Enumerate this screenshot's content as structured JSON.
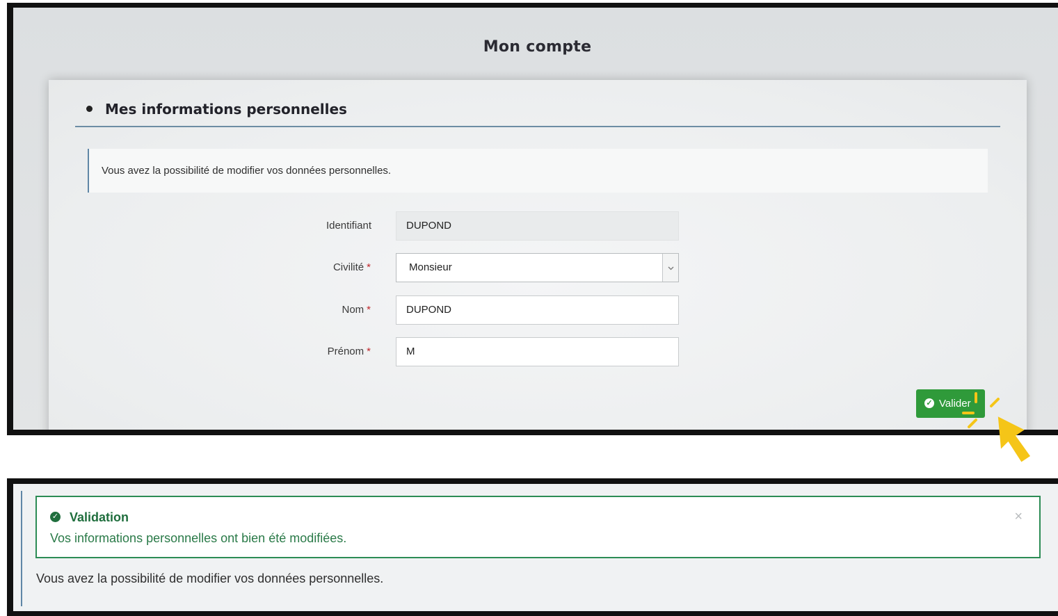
{
  "account": {
    "page_title": "Mon compte",
    "section_title": "Mes informations personnelles",
    "info_text": "Vous avez la possibilité de modifier vos données personnelles.",
    "required_mark": "*",
    "fields": {
      "identifiant": {
        "label": "Identifiant",
        "value": "DUPOND"
      },
      "civilite": {
        "label": "Civilité",
        "value": "Monsieur"
      },
      "nom": {
        "label": "Nom",
        "value": "DUPOND"
      },
      "prenom": {
        "label": "Prénom",
        "value": "M"
      }
    },
    "validate_label": "Valider"
  },
  "confirmation": {
    "alert_title": "Validation",
    "alert_message": "Vos informations personnelles ont bien été modifiées.",
    "close_symbol": "×",
    "info_text": "Vous avez la possibilité de modifier vos données personnelles."
  },
  "icons": {
    "check": "check-circle-icon",
    "chevron": "chevron-down-icon",
    "cursor": "hand-pointer-icon"
  },
  "colors": {
    "success_green": "#2f9a3a",
    "alert_border": "#2c8c55",
    "required_red": "#c0282d",
    "cursor_yellow": "#f5c518",
    "section_rule": "#6d8da4"
  }
}
